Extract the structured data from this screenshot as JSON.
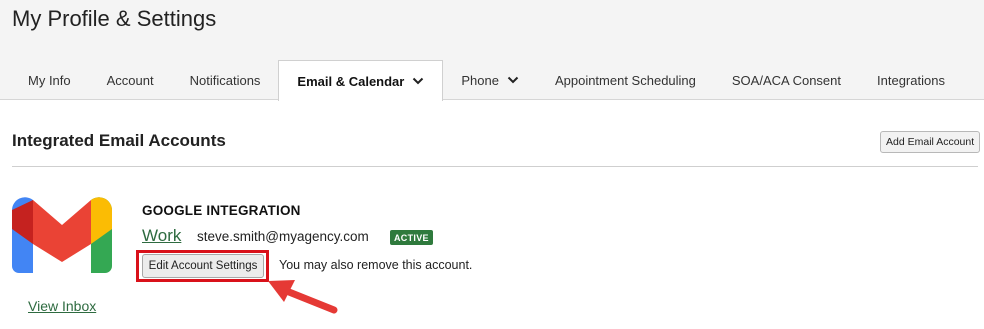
{
  "page": {
    "title": "My Profile & Settings"
  },
  "tabs": [
    {
      "label": "My Info"
    },
    {
      "label": "Account"
    },
    {
      "label": "Notifications"
    },
    {
      "label": "Email & Calendar",
      "active": true,
      "has_dropdown": true
    },
    {
      "label": "Phone",
      "has_dropdown": true
    },
    {
      "label": "Appointment Scheduling"
    },
    {
      "label": "SOA/ACA Consent"
    },
    {
      "label": "Integrations"
    }
  ],
  "section": {
    "title": "Integrated Email Accounts",
    "add_button_label": "Add Email Account"
  },
  "integration": {
    "logo_icon": "gmail-logo-icon",
    "title": "GOOGLE INTEGRATION",
    "account_label": "Work",
    "email": "steve.smith@myagency.com",
    "status": "ACTIVE",
    "edit_button_label": "Edit Account Settings",
    "remove_text": "You may also remove this account.",
    "view_inbox_label": "View Inbox"
  },
  "colors": {
    "accent_green": "#2e6b40",
    "badge_green": "#2f7a3d",
    "highlight_red": "#d9111a",
    "header_bg": "#f4f4f4"
  }
}
